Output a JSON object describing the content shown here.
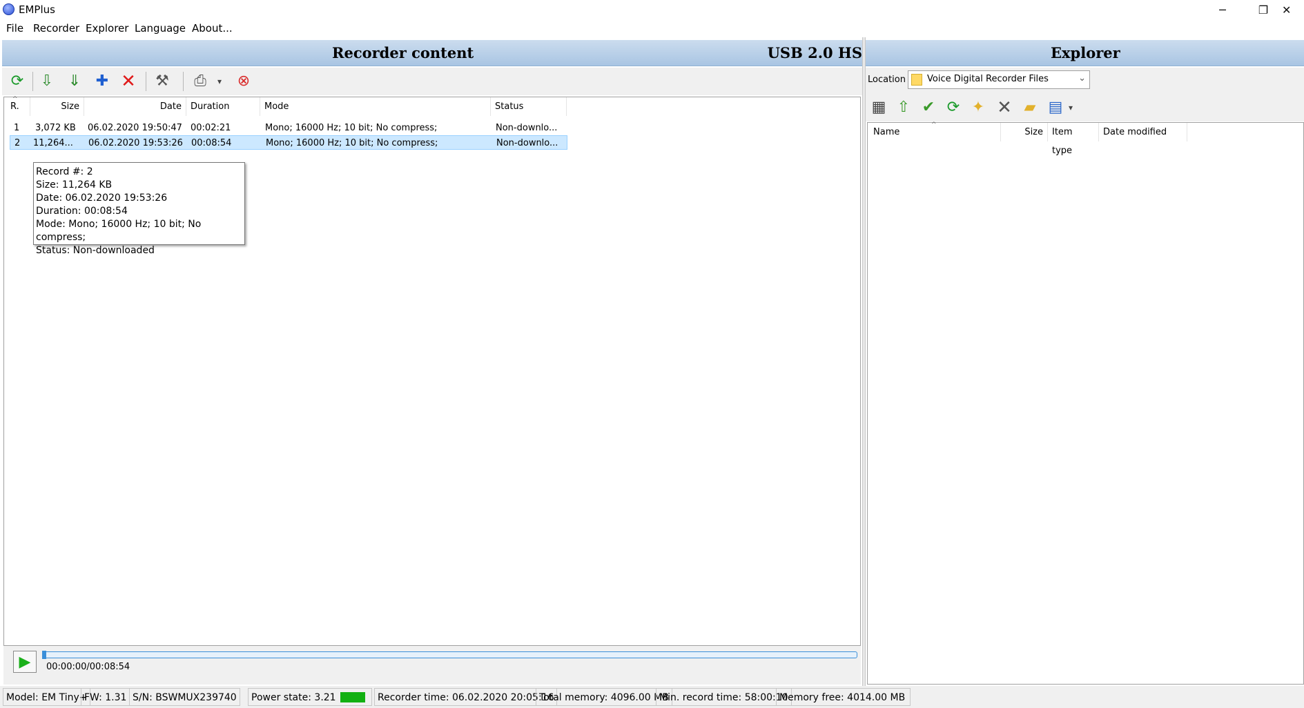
{
  "window": {
    "title": "EMPlus",
    "minimize": "─",
    "restore": "❐",
    "close": "✕"
  },
  "menu": [
    "File",
    "Recorder",
    "Explorer",
    "Language",
    "About..."
  ],
  "recorder": {
    "title": "Recorder content",
    "usb_label": "USB 2.0 HS",
    "columns": [
      "R.",
      "Size",
      "Date",
      "Duration",
      "Mode",
      "Status"
    ],
    "rows": [
      {
        "r": "1",
        "size": "3,072 KB",
        "date": "06.02.2020 19:50:47",
        "duration": "00:02:21",
        "mode": "Mono; 16000 Hz; 10 bit; No compress;",
        "status": "Non-downlo..."
      },
      {
        "r": "2",
        "size": "11,264...",
        "date": "06.02.2020 19:53:26",
        "duration": "00:08:54",
        "mode": "Mono; 16000 Hz; 10 bit; No compress;",
        "status": "Non-downlo..."
      }
    ],
    "tooltip": [
      "Record #: 2",
      "Size: 11,264 KB",
      "Date: 06.02.2020 19:53:26",
      "Duration: 00:08:54",
      "Mode: Mono; 16000 Hz; 10 bit; No compress;",
      "Status: Non-downloaded"
    ],
    "player": {
      "time": "00:00:00/00:08:54",
      "progress": 0.0
    }
  },
  "explorer": {
    "title": "Explorer",
    "location_label": "Location",
    "location_value": "Voice Digital Recorder Files",
    "columns": [
      "Name",
      "Size",
      "Item type",
      "Date modified"
    ]
  },
  "status": {
    "model": "Model: EM Tiny+",
    "fw": "FW: 1.31",
    "sn": "S/N: BSWMUX239740",
    "power": "Power state: 3.21",
    "recorder_time": "Recorder time: 06.02.2020 20:05:16",
    "total_memory": "Total memory: 4096.00 MB",
    "min_record": "Min. record time: 58:00:10",
    "memory_free": "Memory free: 4014.00 MB"
  },
  "colors": {
    "header": "#b8cfe8",
    "selected_row": "#cce8ff",
    "battery": "#12b012",
    "progress": "#3a8fd9"
  }
}
